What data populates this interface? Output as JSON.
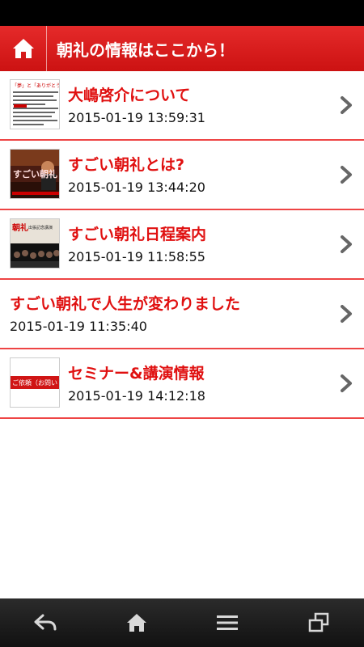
{
  "header": {
    "title": "朝礼の情報はここから！"
  },
  "items": [
    {
      "title": "大嶋啓介について",
      "date": "2015-01-19 13:59:31",
      "has_thumb": true
    },
    {
      "title": "すごい朝礼とは?",
      "date": "2015-01-19 13:44:20",
      "has_thumb": true
    },
    {
      "title": "すごい朝礼日程案内",
      "date": "2015-01-19 11:58:55",
      "has_thumb": true
    },
    {
      "title": "すごい朝礼で人生が変わりました",
      "date": "2015-01-19 11:35:40",
      "has_thumb": false
    },
    {
      "title": "セミナー&講演情報",
      "date": "2015-01-19 14:12:18",
      "has_thumb": true
    }
  ],
  "thumbs": {
    "t1_text": "「夢」と「ありがとう」",
    "t2_text": "すごい朝礼",
    "t3_text": "朝礼",
    "t3_sub": "出張記念講演",
    "t5_text": "ご依頼（お問い"
  },
  "colors": {
    "accent": "#e01010",
    "header": "#d91b1b",
    "nav": "#1a1a1a"
  }
}
